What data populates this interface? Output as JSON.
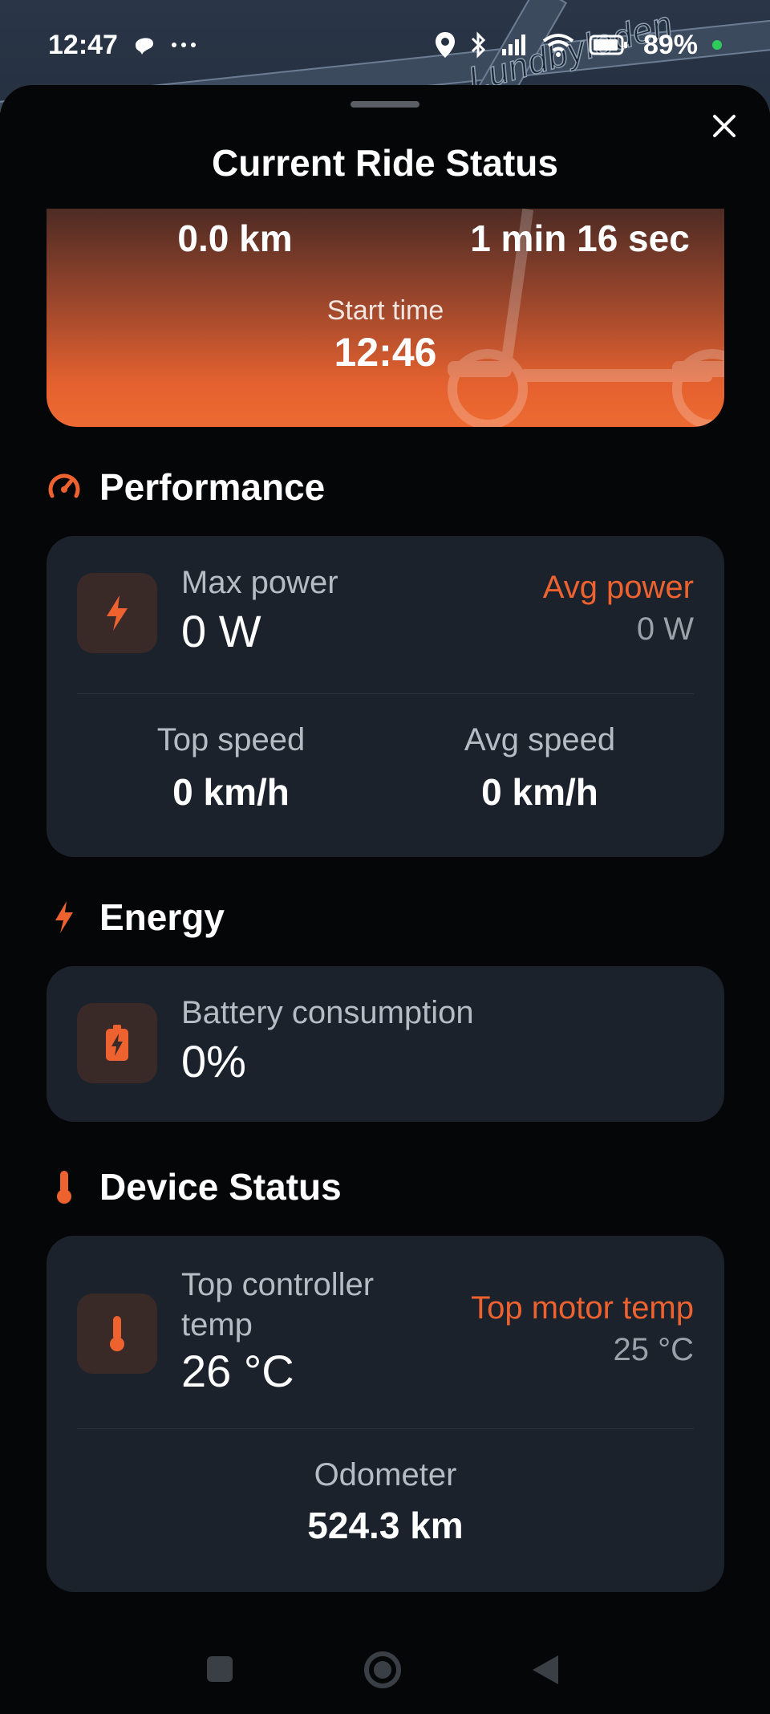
{
  "status_bar": {
    "time": "12:47",
    "battery": "89%",
    "icons": [
      "notification-blob-icon",
      "more-dots-icon",
      "location-icon",
      "bluetooth-icon",
      "signal-icon",
      "wifi-icon",
      "battery-icon"
    ]
  },
  "map": {
    "label": "Lundbyleden"
  },
  "sheet": {
    "title": "Current Ride Status",
    "close_icon": "close-icon"
  },
  "hero": {
    "distance": "0.0 km",
    "duration": "1 min 16 sec",
    "start_label": "Start time",
    "start_value": "12:46"
  },
  "performance": {
    "title": "Performance",
    "icon": "speedometer-icon",
    "max_power_label": "Max power",
    "max_power_value": "0 W",
    "avg_power_label": "Avg power",
    "avg_power_value": "0 W",
    "top_speed_label": "Top speed",
    "top_speed_value": "0 km/h",
    "avg_speed_label": "Avg speed",
    "avg_speed_value": "0 km/h"
  },
  "energy": {
    "title": "Energy",
    "icon": "lightning-icon",
    "battery_label": "Battery consumption",
    "battery_value": "0%"
  },
  "device": {
    "title": "Device Status",
    "icon": "thermometer-icon",
    "controller_label_line1": "Top controller",
    "controller_label_line2": "temp",
    "controller_value": "26 °C",
    "motor_label": "Top motor temp",
    "motor_value": "25 °C",
    "odometer_label": "Odometer",
    "odometer_value": "524.3 km"
  },
  "nav": [
    "recents-button",
    "home-button",
    "back-button"
  ],
  "colors": {
    "accent": "#ee6230",
    "card": "#1b222c",
    "background": "#050608"
  }
}
